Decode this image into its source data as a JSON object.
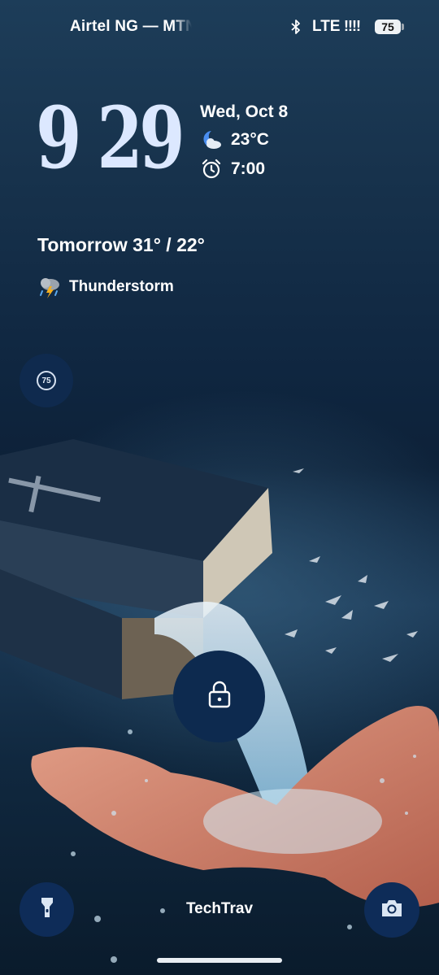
{
  "status_bar": {
    "carrier": "Airtel NG — MTN",
    "network": "LTE",
    "signal": "!!!!",
    "battery": "75"
  },
  "clock": {
    "time": "9 29"
  },
  "info": {
    "date": "Wed, Oct 8",
    "temperature": "23°C",
    "alarm": "7:00"
  },
  "forecast": {
    "tomorrow": "Tomorrow 31° / 22°",
    "condition": "Thunderstorm"
  },
  "aod": {
    "battery_badge": "75"
  },
  "owner_info": "TechTrav",
  "icons": {
    "bluetooth": "bluetooth-icon",
    "weather_now": "partly-cloudy-night-icon",
    "alarm": "alarm-clock-icon",
    "weather_tomorrow": "thunderstorm-icon",
    "lock": "lock-icon",
    "flashlight": "flashlight-icon",
    "camera": "camera-icon"
  },
  "colors": {
    "clock": "#dce8ff",
    "button_bg": "#0e2c58"
  }
}
